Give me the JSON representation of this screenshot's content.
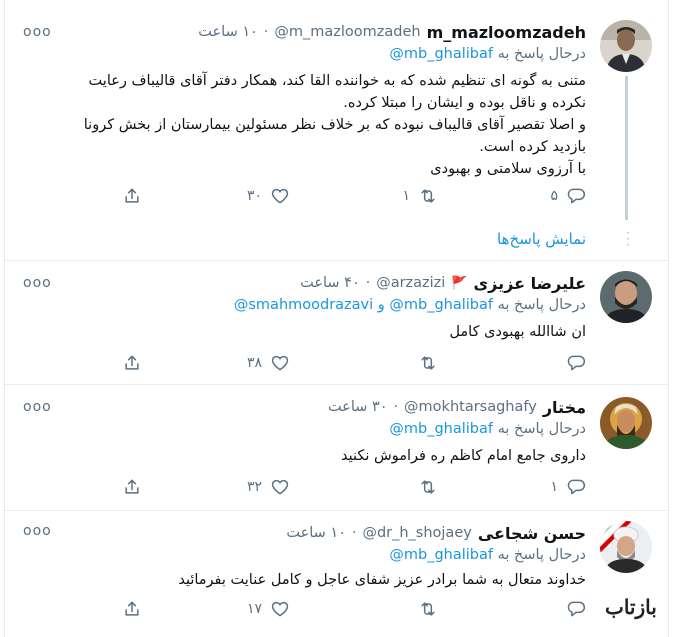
{
  "tweets": [
    {
      "name": "m_mazloomzadeh",
      "handle": "@m_mazloomzadeh",
      "time": "۱۰ ساعت",
      "reply_prefix": "درحال پاسخ به",
      "reply_to": "@mb_ghalibaf",
      "reply_and": "",
      "reply_to2": "",
      "lines": [
        "متنی به گونه ای تنظیم شده که به خواننده القا کند، همکار دفتر آقای قالیباف رعایت",
        "نکرده و ناقل بوده و ایشان را مبتلا کرده.",
        "و اصلا تقصیر آقای قالیباف نبوده که بر خلاف نظر مسئولین بیمارستان از بخش کرونا",
        "بازدید کرده است.",
        "با آرزوی سلامتی و بهبودی"
      ],
      "reply_count": "۵",
      "retweet_count": "۱",
      "like_count": "۳۰",
      "show_replies": "نمایش پاسخ‌ها"
    },
    {
      "name": "علیرضا عزیزی",
      "flag": "🚩",
      "handle": "@arzazizi",
      "time": "۴۰ ساعت",
      "reply_prefix": "درحال پاسخ به",
      "reply_to": "@mb_ghalibaf",
      "reply_and": "و",
      "reply_to2": "@smahmoodrazavi",
      "lines": [
        "ان شاالله بهبودی کامل"
      ],
      "reply_count": "",
      "retweet_count": "",
      "like_count": "۳۸"
    },
    {
      "name": "مختار",
      "handle": "@mokhtarsaghafy",
      "time": "۳۰ ساعت",
      "reply_prefix": "درحال پاسخ به",
      "reply_to": "@mb_ghalibaf",
      "lines": [
        "داروی جامع امام کاظم ره فراموش نکنید"
      ],
      "reply_count": "۱",
      "retweet_count": "",
      "like_count": "۳۲"
    },
    {
      "name": "حسن شجاعی",
      "handle": "@dr_h_shojaey",
      "time": "۱۰ ساعت",
      "reply_prefix": "درحال پاسخ به",
      "reply_to": "@mb_ghalibaf",
      "lines": [
        "خداوند متعال به شما برادر عزیز شفای عاجل و کامل عنایت بفرمائید"
      ],
      "reply_count": "",
      "retweet_count": "",
      "like_count": "۱۷"
    }
  ],
  "more_glyph": "ooo",
  "watermark": {
    "text": "بازتاب"
  },
  "colors": {
    "link": "#1b95e0",
    "muted": "#5b7083",
    "text": "#0f1419",
    "divider": "#e6ecf0",
    "flag": "#e0245e"
  }
}
